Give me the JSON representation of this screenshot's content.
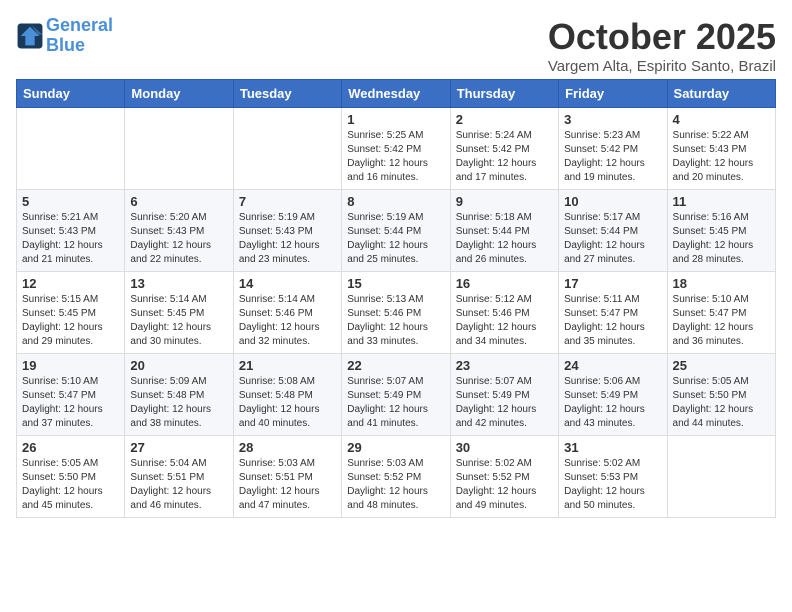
{
  "logo": {
    "line1": "General",
    "line2": "Blue"
  },
  "title": "October 2025",
  "subtitle": "Vargem Alta, Espirito Santo, Brazil",
  "weekdays": [
    "Sunday",
    "Monday",
    "Tuesday",
    "Wednesday",
    "Thursday",
    "Friday",
    "Saturday"
  ],
  "weeks": [
    [
      {
        "day": "",
        "info": ""
      },
      {
        "day": "",
        "info": ""
      },
      {
        "day": "",
        "info": ""
      },
      {
        "day": "1",
        "info": "Sunrise: 5:25 AM\nSunset: 5:42 PM\nDaylight: 12 hours\nand 16 minutes."
      },
      {
        "day": "2",
        "info": "Sunrise: 5:24 AM\nSunset: 5:42 PM\nDaylight: 12 hours\nand 17 minutes."
      },
      {
        "day": "3",
        "info": "Sunrise: 5:23 AM\nSunset: 5:42 PM\nDaylight: 12 hours\nand 19 minutes."
      },
      {
        "day": "4",
        "info": "Sunrise: 5:22 AM\nSunset: 5:43 PM\nDaylight: 12 hours\nand 20 minutes."
      }
    ],
    [
      {
        "day": "5",
        "info": "Sunrise: 5:21 AM\nSunset: 5:43 PM\nDaylight: 12 hours\nand 21 minutes."
      },
      {
        "day": "6",
        "info": "Sunrise: 5:20 AM\nSunset: 5:43 PM\nDaylight: 12 hours\nand 22 minutes."
      },
      {
        "day": "7",
        "info": "Sunrise: 5:19 AM\nSunset: 5:43 PM\nDaylight: 12 hours\nand 23 minutes."
      },
      {
        "day": "8",
        "info": "Sunrise: 5:19 AM\nSunset: 5:44 PM\nDaylight: 12 hours\nand 25 minutes."
      },
      {
        "day": "9",
        "info": "Sunrise: 5:18 AM\nSunset: 5:44 PM\nDaylight: 12 hours\nand 26 minutes."
      },
      {
        "day": "10",
        "info": "Sunrise: 5:17 AM\nSunset: 5:44 PM\nDaylight: 12 hours\nand 27 minutes."
      },
      {
        "day": "11",
        "info": "Sunrise: 5:16 AM\nSunset: 5:45 PM\nDaylight: 12 hours\nand 28 minutes."
      }
    ],
    [
      {
        "day": "12",
        "info": "Sunrise: 5:15 AM\nSunset: 5:45 PM\nDaylight: 12 hours\nand 29 minutes."
      },
      {
        "day": "13",
        "info": "Sunrise: 5:14 AM\nSunset: 5:45 PM\nDaylight: 12 hours\nand 30 minutes."
      },
      {
        "day": "14",
        "info": "Sunrise: 5:14 AM\nSunset: 5:46 PM\nDaylight: 12 hours\nand 32 minutes."
      },
      {
        "day": "15",
        "info": "Sunrise: 5:13 AM\nSunset: 5:46 PM\nDaylight: 12 hours\nand 33 minutes."
      },
      {
        "day": "16",
        "info": "Sunrise: 5:12 AM\nSunset: 5:46 PM\nDaylight: 12 hours\nand 34 minutes."
      },
      {
        "day": "17",
        "info": "Sunrise: 5:11 AM\nSunset: 5:47 PM\nDaylight: 12 hours\nand 35 minutes."
      },
      {
        "day": "18",
        "info": "Sunrise: 5:10 AM\nSunset: 5:47 PM\nDaylight: 12 hours\nand 36 minutes."
      }
    ],
    [
      {
        "day": "19",
        "info": "Sunrise: 5:10 AM\nSunset: 5:47 PM\nDaylight: 12 hours\nand 37 minutes."
      },
      {
        "day": "20",
        "info": "Sunrise: 5:09 AM\nSunset: 5:48 PM\nDaylight: 12 hours\nand 38 minutes."
      },
      {
        "day": "21",
        "info": "Sunrise: 5:08 AM\nSunset: 5:48 PM\nDaylight: 12 hours\nand 40 minutes."
      },
      {
        "day": "22",
        "info": "Sunrise: 5:07 AM\nSunset: 5:49 PM\nDaylight: 12 hours\nand 41 minutes."
      },
      {
        "day": "23",
        "info": "Sunrise: 5:07 AM\nSunset: 5:49 PM\nDaylight: 12 hours\nand 42 minutes."
      },
      {
        "day": "24",
        "info": "Sunrise: 5:06 AM\nSunset: 5:49 PM\nDaylight: 12 hours\nand 43 minutes."
      },
      {
        "day": "25",
        "info": "Sunrise: 5:05 AM\nSunset: 5:50 PM\nDaylight: 12 hours\nand 44 minutes."
      }
    ],
    [
      {
        "day": "26",
        "info": "Sunrise: 5:05 AM\nSunset: 5:50 PM\nDaylight: 12 hours\nand 45 minutes."
      },
      {
        "day": "27",
        "info": "Sunrise: 5:04 AM\nSunset: 5:51 PM\nDaylight: 12 hours\nand 46 minutes."
      },
      {
        "day": "28",
        "info": "Sunrise: 5:03 AM\nSunset: 5:51 PM\nDaylight: 12 hours\nand 47 minutes."
      },
      {
        "day": "29",
        "info": "Sunrise: 5:03 AM\nSunset: 5:52 PM\nDaylight: 12 hours\nand 48 minutes."
      },
      {
        "day": "30",
        "info": "Sunrise: 5:02 AM\nSunset: 5:52 PM\nDaylight: 12 hours\nand 49 minutes."
      },
      {
        "day": "31",
        "info": "Sunrise: 5:02 AM\nSunset: 5:53 PM\nDaylight: 12 hours\nand 50 minutes."
      },
      {
        "day": "",
        "info": ""
      }
    ]
  ]
}
